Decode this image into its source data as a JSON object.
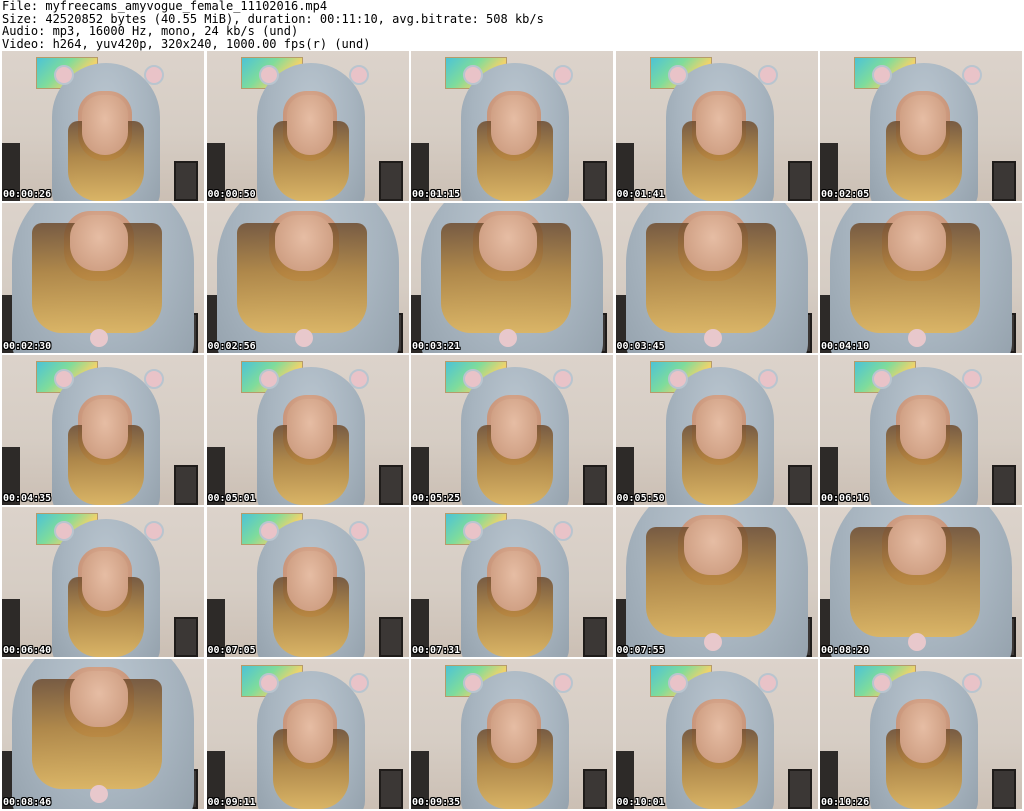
{
  "header": {
    "file_line": "File: myfreecams_amyvogue_female_11102016.mp4",
    "size_line": "Size: 42520852 bytes (40.55 MiB), duration: 00:11:10, avg.bitrate: 508 kb/s",
    "audio_line": "Audio: mp3, 16000 Hz, mono, 24 kb/s (und)",
    "video_line": "Video: h264, yuv420p, 320x240, 1000.00 fps(r) (und)"
  },
  "thumbnails": [
    {
      "timestamp": "00:00:26",
      "pose": "upright"
    },
    {
      "timestamp": "00:00:50",
      "pose": "upright"
    },
    {
      "timestamp": "00:01:15",
      "pose": "upright"
    },
    {
      "timestamp": "00:01:41",
      "pose": "upright"
    },
    {
      "timestamp": "00:02:05",
      "pose": "upright"
    },
    {
      "timestamp": "00:02:30",
      "pose": "leaning"
    },
    {
      "timestamp": "00:02:56",
      "pose": "leaning"
    },
    {
      "timestamp": "00:03:21",
      "pose": "leaning"
    },
    {
      "timestamp": "00:03:45",
      "pose": "leaning"
    },
    {
      "timestamp": "00:04:10",
      "pose": "leaning"
    },
    {
      "timestamp": "00:04:35",
      "pose": "upright"
    },
    {
      "timestamp": "00:05:01",
      "pose": "upright"
    },
    {
      "timestamp": "00:05:25",
      "pose": "upright"
    },
    {
      "timestamp": "00:05:50",
      "pose": "upright"
    },
    {
      "timestamp": "00:06:16",
      "pose": "upright"
    },
    {
      "timestamp": "00:06:40",
      "pose": "upright"
    },
    {
      "timestamp": "00:07:05",
      "pose": "upright"
    },
    {
      "timestamp": "00:07:31",
      "pose": "upright"
    },
    {
      "timestamp": "00:07:55",
      "pose": "leaning"
    },
    {
      "timestamp": "00:08:20",
      "pose": "leaning"
    },
    {
      "timestamp": "00:08:46",
      "pose": "leaning"
    },
    {
      "timestamp": "00:09:11",
      "pose": "upright"
    },
    {
      "timestamp": "00:09:35",
      "pose": "upright"
    },
    {
      "timestamp": "00:10:01",
      "pose": "upright"
    },
    {
      "timestamp": "00:10:26",
      "pose": "upright"
    }
  ],
  "colors": {
    "background": "#ffffff",
    "timestamp_text": "#ffffff",
    "timestamp_outline": "#000000",
    "hoodie": "#a7b4bf",
    "ear": "#e9c3c8",
    "wall": "#d6cdc4"
  }
}
